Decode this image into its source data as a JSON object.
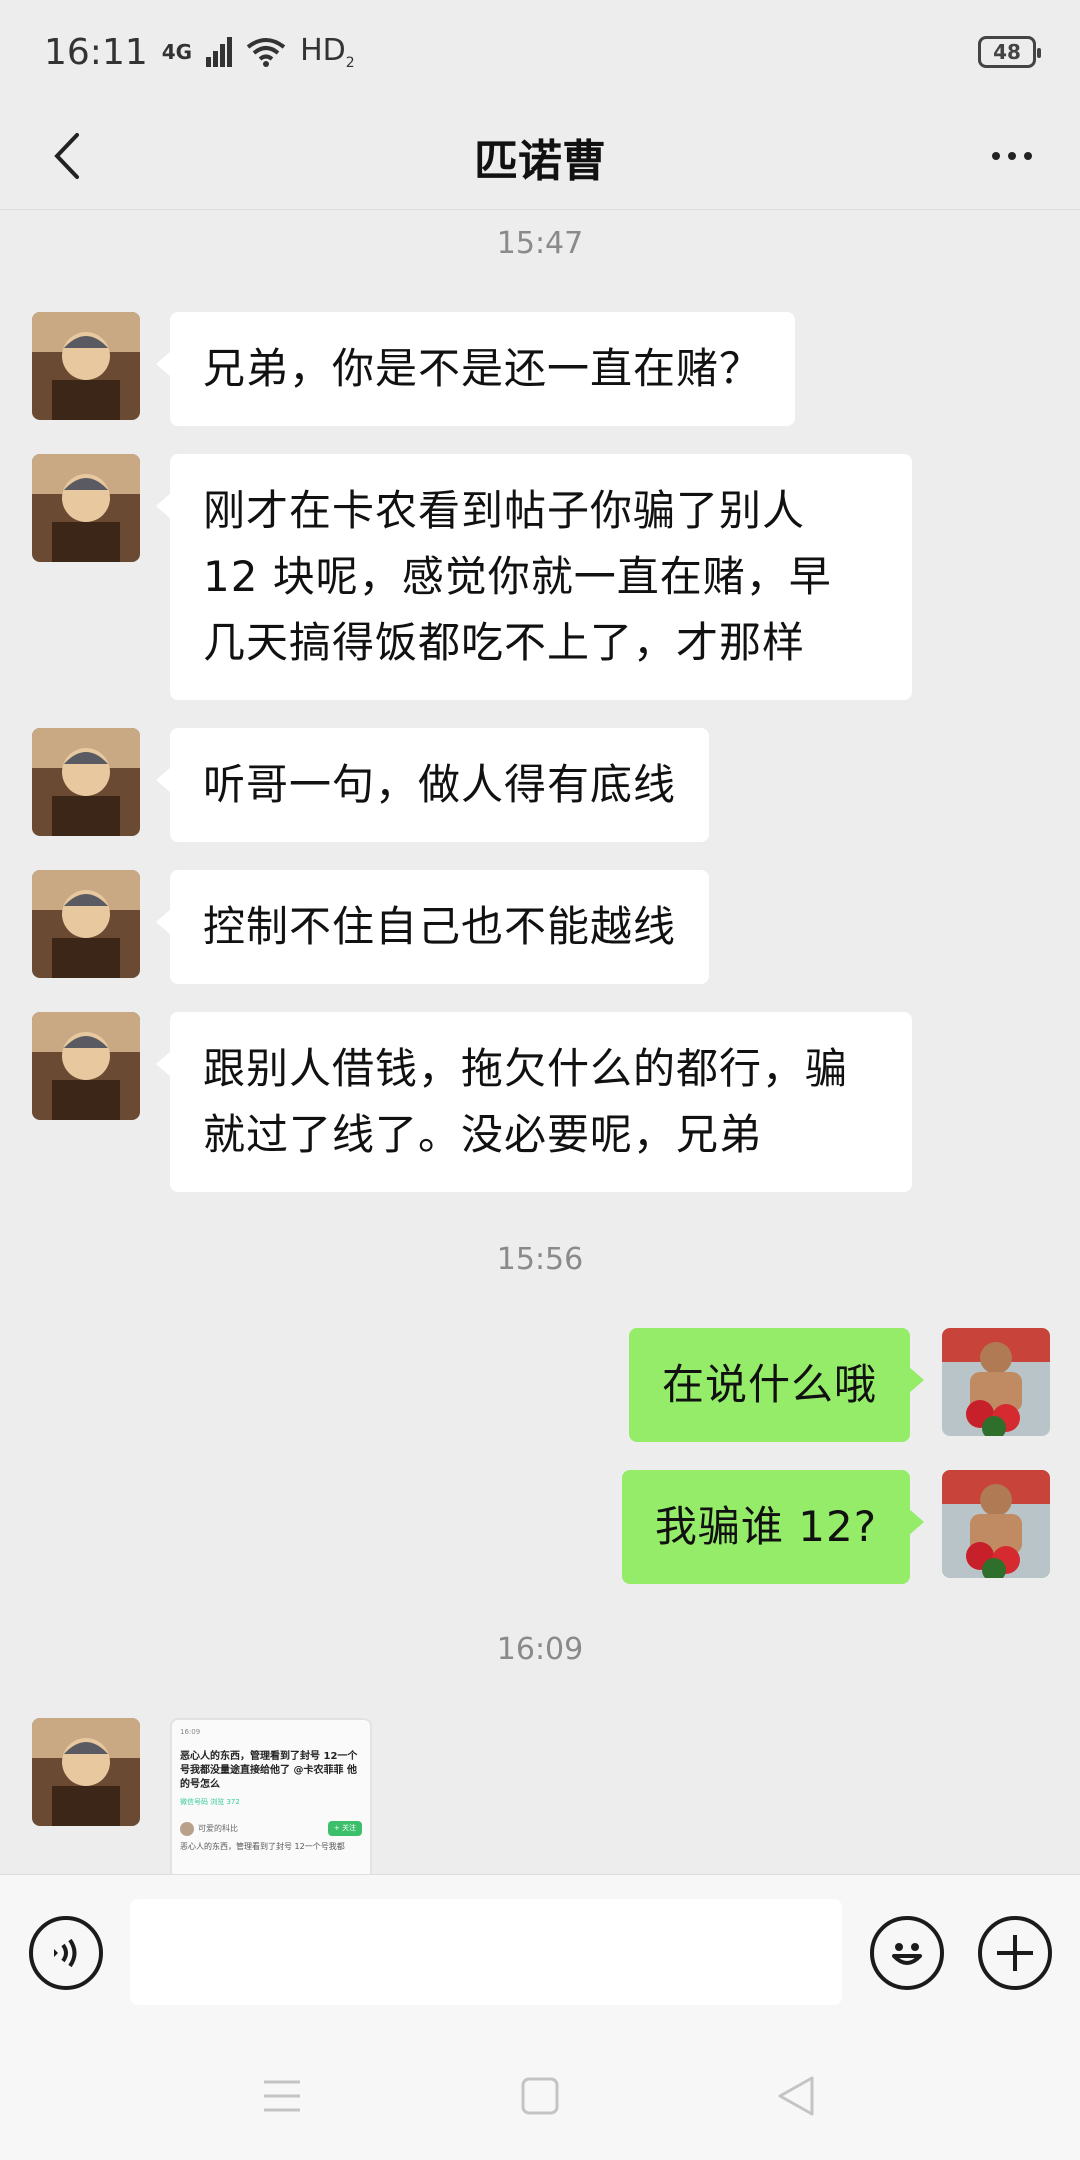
{
  "status_bar": {
    "time": "16:11",
    "network": "4G",
    "hd": "HD",
    "hd_sub": "2",
    "battery": "48"
  },
  "header": {
    "title": "匹诺曹"
  },
  "messages": [
    {
      "type": "timestamp",
      "text": "15:47"
    },
    {
      "type": "incoming",
      "text": "兄弟，你是不是还一直在赌？"
    },
    {
      "type": "incoming",
      "lines": [
        "刚才在卡农看到帖子你骗了别人",
        "12 块呢，感觉你就一直在赌，早",
        "几天搞得饭都吃不上了，才那样"
      ]
    },
    {
      "type": "incoming",
      "text": "听哥一句，做人得有底线"
    },
    {
      "type": "incoming",
      "text": "控制不住自己也不能越线"
    },
    {
      "type": "incoming",
      "lines": [
        "跟别人借钱，拖欠什么的都行，骗",
        "就过了线了。没必要呢，兄弟"
      ]
    },
    {
      "type": "timestamp",
      "text": "15:56"
    },
    {
      "type": "outgoing",
      "text": "在说什么哦"
    },
    {
      "type": "outgoing",
      "text": "我骗谁 12?"
    },
    {
      "type": "timestamp",
      "text": "16:09"
    },
    {
      "type": "incoming_image",
      "thumb": {
        "status": "16:09",
        "title": "恶心人的东西，管理看到了封号 12一个号我都没量途直接给他了 @卡农菲菲 他的号怎么",
        "tags": "微信号码   浏览 372",
        "user": "可爱的科比",
        "button": "+ 关注",
        "body": "恶心人的东西，管理看到了封号 12一个号我都"
      }
    }
  ],
  "input": {
    "placeholder": ""
  },
  "icons": {
    "back": "back-arrow-icon",
    "more": "more-dots-icon",
    "voice": "voice-icon",
    "emoji": "emoji-icon",
    "plus": "plus-icon"
  },
  "colors": {
    "background": "#ededed",
    "outgoing_bubble": "#95ec69",
    "incoming_bubble": "#ffffff"
  }
}
